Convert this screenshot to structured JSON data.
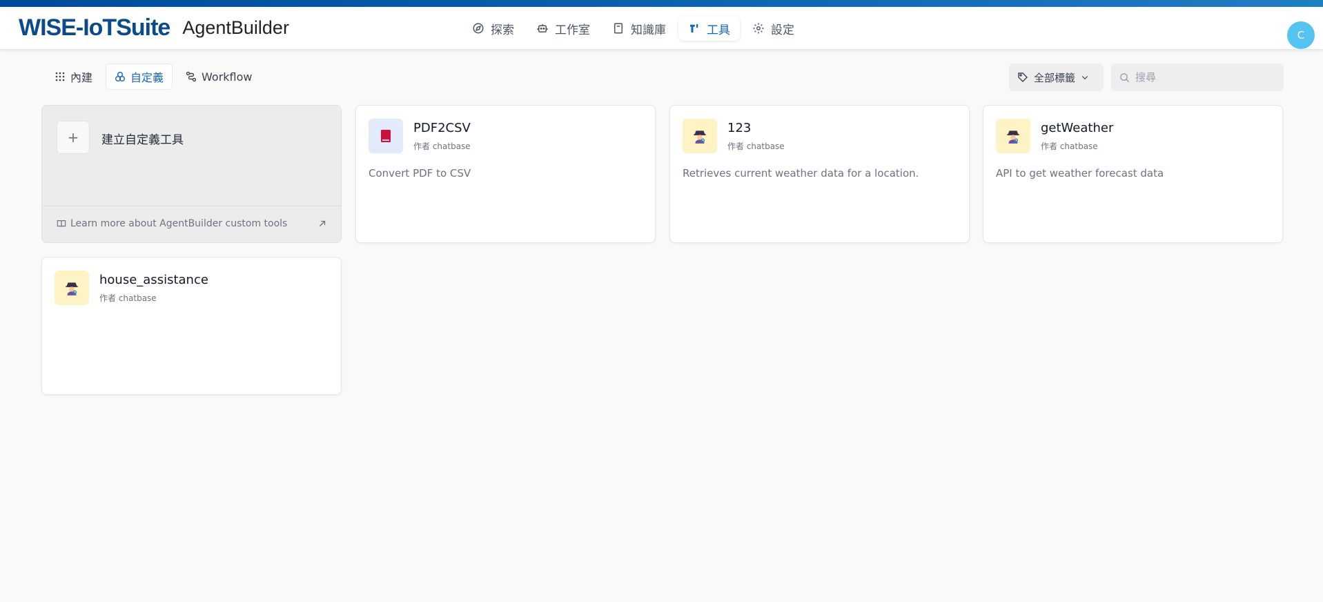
{
  "header": {
    "brand_main": "WISE-IoTSuite",
    "brand_sub": "AgentBuilder",
    "nav": [
      {
        "label": "探索",
        "icon": "compass-icon",
        "active": false
      },
      {
        "label": "工作室",
        "icon": "robot-icon",
        "active": false
      },
      {
        "label": "知識庫",
        "icon": "book-icon",
        "active": false
      },
      {
        "label": "工具",
        "icon": "tools-icon",
        "active": true
      },
      {
        "label": "設定",
        "icon": "gear-icon",
        "active": false
      }
    ],
    "avatar_initial": "C"
  },
  "subtabs": [
    {
      "label": "內建",
      "icon": "grid-icon",
      "active": false
    },
    {
      "label": "自定義",
      "icon": "circles-icon",
      "active": true
    },
    {
      "label": "Workflow",
      "icon": "workflow-icon",
      "active": false
    }
  ],
  "filters": {
    "tag_label": "全部標籤",
    "search_placeholder": "搜尋"
  },
  "create_card": {
    "label": "建立自定義工具",
    "learn_more": "Learn more about AgentBuilder custom tools"
  },
  "tools": [
    {
      "name": "PDF2CSV",
      "author": "作者 chatbase",
      "description": "Convert PDF to CSV",
      "icon": "book-red-icon"
    },
    {
      "name": "123",
      "author": "作者 chatbase",
      "description": "Retrieves current weather data for a location.",
      "icon": "detective-icon"
    },
    {
      "name": "getWeather",
      "author": "作者 chatbase",
      "description": "API to get weather forecast data",
      "icon": "detective-icon"
    },
    {
      "name": "house_assistance",
      "author": "作者 chatbase",
      "description": "",
      "icon": "detective-icon"
    }
  ],
  "colors": {
    "accent": "#1565c0",
    "brand": "#0b4a8b",
    "avatar_bg": "#54c3ef"
  }
}
